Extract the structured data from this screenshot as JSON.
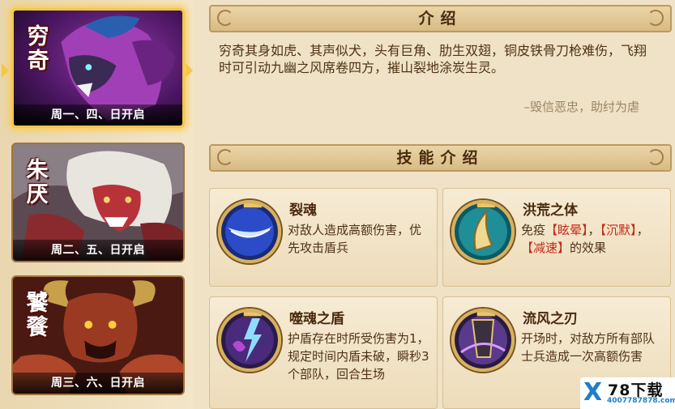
{
  "heroes": [
    {
      "name": "穷奇",
      "schedule": "周一、四、日开启",
      "selected": true
    },
    {
      "name": "朱厌",
      "schedule": "周二、五、日开启",
      "selected": false
    },
    {
      "name": "饕餮",
      "schedule": "周三、六、日开启",
      "selected": false
    }
  ],
  "intro": {
    "title": "介绍",
    "text": "穷奇其身如虎、其声似犬，头有巨角、肋生双翅，铜皮铁骨刀枪难伤，飞翔时可引动九幽之风席卷四方，摧山裂地涂炭生灵。",
    "quote": "–毁信恶忠，助纣为虐"
  },
  "skills_section": {
    "title": "技能介绍",
    "skills": [
      {
        "name": "裂魂",
        "icon": "crescent-slash-icon",
        "desc_parts": [
          {
            "t": "对敌人造成高额伤害，优先攻击盾兵",
            "hl": false
          }
        ]
      },
      {
        "name": "洪荒之体",
        "icon": "horn-icon",
        "desc_parts": [
          {
            "t": "免疫",
            "hl": false
          },
          {
            "t": "【眩晕】",
            "hl": true
          },
          {
            "t": "，",
            "hl": false
          },
          {
            "t": "【沉默】",
            "hl": true
          },
          {
            "t": "，",
            "hl": false
          },
          {
            "t": "【减速】",
            "hl": true
          },
          {
            "t": "的效果",
            "hl": false
          }
        ]
      },
      {
        "name": "噬魂之盾",
        "icon": "lightning-shield-icon",
        "desc_parts": [
          {
            "t": "护盾存在时所受伤害为1，规定时间内盾未破，瞬秒3个部队，回合生场",
            "hl": false
          }
        ]
      },
      {
        "name": "流风之刃",
        "icon": "wind-blade-icon",
        "desc_parts": [
          {
            "t": "开场时，对敌方所有部队士兵造成一次高额伤害",
            "hl": false
          }
        ]
      }
    ]
  },
  "watermark": {
    "brand": "78下载",
    "url": "4007787878.com",
    "logo": "X"
  },
  "colors": {
    "highlight": "#c42a18",
    "text": "#4f3216",
    "selected_glow": "#f2c84a"
  }
}
